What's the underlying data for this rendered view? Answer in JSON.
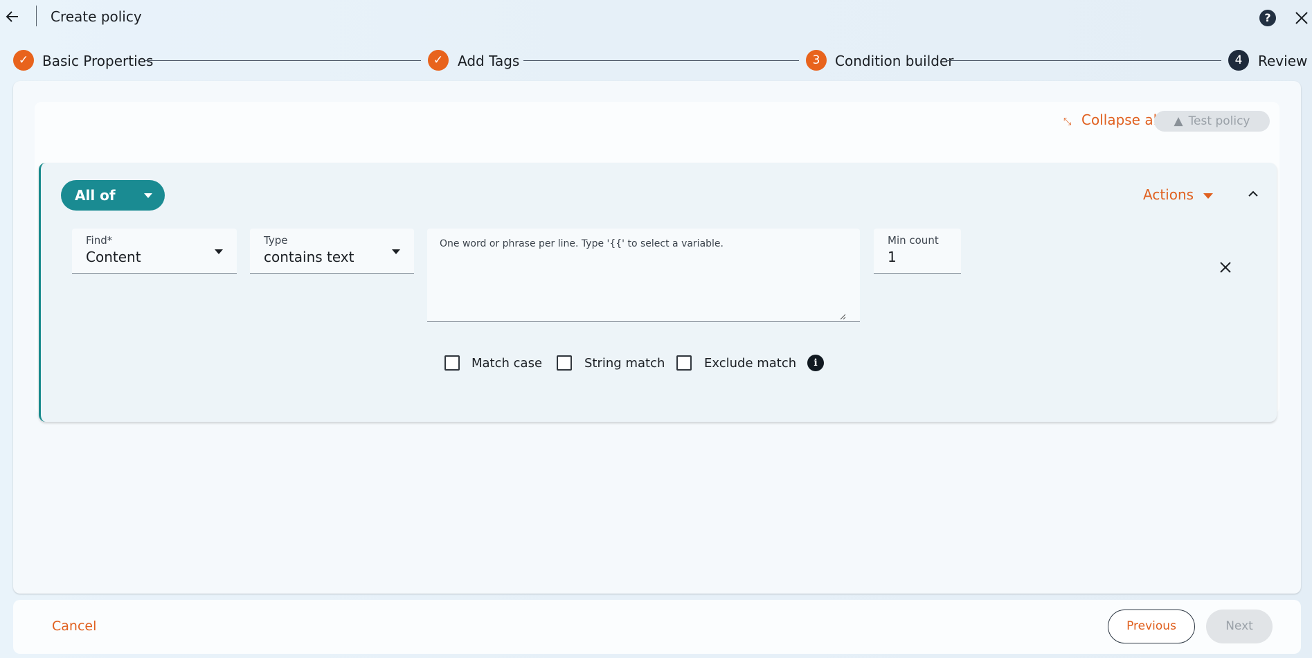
{
  "header": {
    "title": "Create policy",
    "help_label": "?"
  },
  "stepper": {
    "steps": [
      {
        "label": "Basic Properties",
        "status": "completed",
        "marker": "✓"
      },
      {
        "label": "Add Tags",
        "status": "completed",
        "marker": "✓"
      },
      {
        "label": "Condition builder",
        "status": "active",
        "marker": "3"
      },
      {
        "label": "Review",
        "status": "pending",
        "marker": "4"
      }
    ]
  },
  "toolbar": {
    "collapse_all_label": "Collapse all",
    "test_policy_label": "Test policy"
  },
  "group": {
    "operator_label": "All of",
    "actions_label": "Actions"
  },
  "condition": {
    "find": {
      "label": "Find*",
      "value": "Content"
    },
    "type": {
      "label": "Type",
      "value": "contains text"
    },
    "text_placeholder": "One word or phrase per line. Type '{{' to select a variable.",
    "min_count": {
      "label": "Min count",
      "value": "1"
    },
    "options": [
      {
        "label": "Match case",
        "checked": false
      },
      {
        "label": "String match",
        "checked": false
      },
      {
        "label": "Exclude match",
        "checked": false
      }
    ],
    "info_label": "i"
  },
  "footer": {
    "cancel_label": "Cancel",
    "previous_label": "Previous",
    "next_label": "Next"
  },
  "colors": {
    "accent": "#e0601f",
    "teal": "#1a8b92",
    "dark": "#1e2a3b"
  }
}
